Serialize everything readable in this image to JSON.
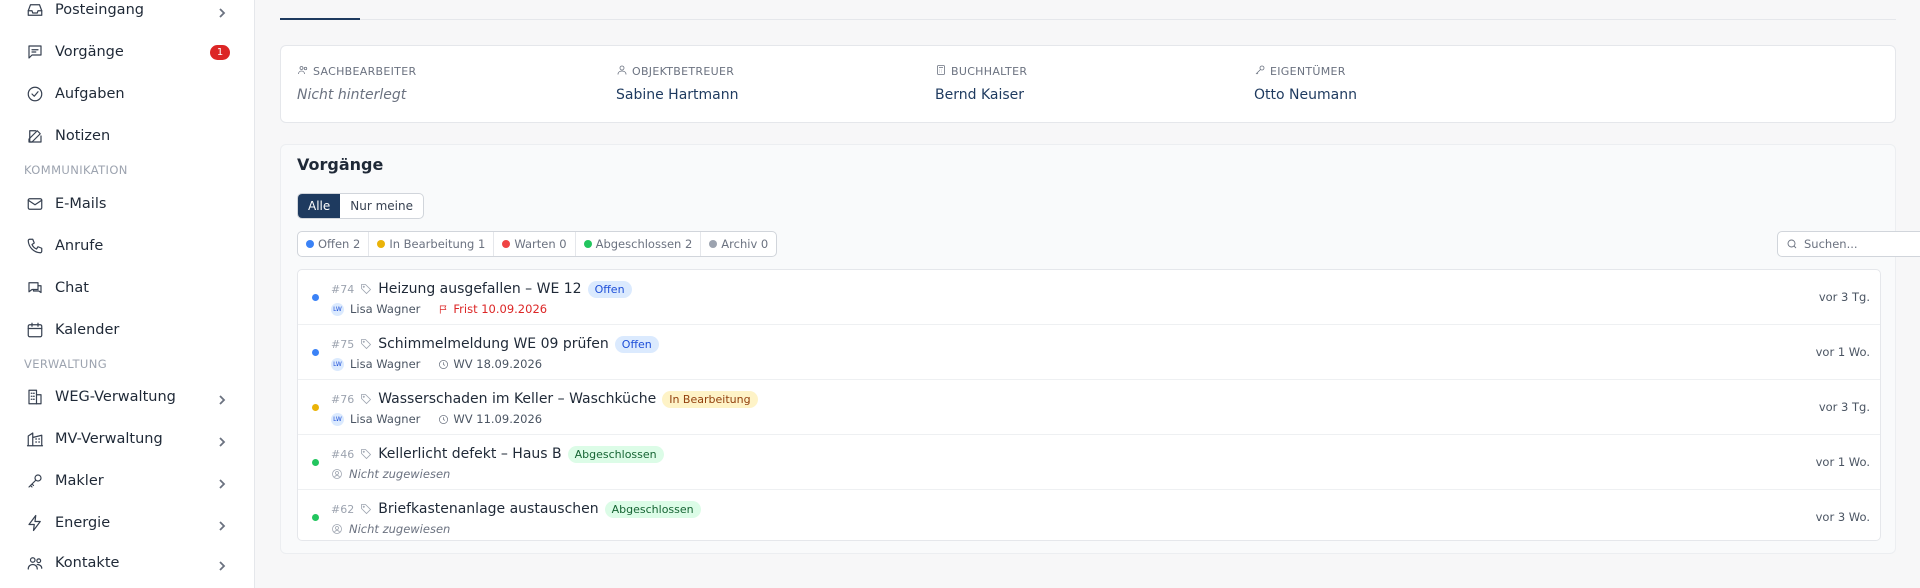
{
  "sidebar": {
    "items": [
      {
        "label": "Posteingang",
        "icon": "inbox-icon",
        "chevron": true
      },
      {
        "label": "Vorgänge",
        "icon": "message-square-icon",
        "badge": "1"
      },
      {
        "label": "Aufgaben",
        "icon": "check-circle-icon"
      },
      {
        "label": "Notizen",
        "icon": "edit-icon"
      }
    ],
    "section_kommunikation": "KOMMUNIKATION",
    "kommunikation": [
      {
        "label": "E-Mails",
        "icon": "mail-icon"
      },
      {
        "label": "Anrufe",
        "icon": "phone-icon"
      },
      {
        "label": "Chat",
        "icon": "chat-icon"
      },
      {
        "label": "Kalender",
        "icon": "calendar-icon"
      }
    ],
    "section_verwaltung": "VERWALTUNG",
    "verwaltung": [
      {
        "label": "WEG-Verwaltung",
        "icon": "building-icon",
        "chevron": true
      },
      {
        "label": "MV-Verwaltung",
        "icon": "buildings-icon",
        "chevron": true
      },
      {
        "label": "Makler",
        "icon": "key-icon",
        "chevron": true
      },
      {
        "label": "Energie",
        "icon": "bolt-icon",
        "chevron": true
      },
      {
        "label": "Kontakte",
        "icon": "users-icon",
        "chevron": true
      }
    ]
  },
  "people": {
    "sachbearbeiter": {
      "label": "SACHBEARBEITER",
      "value": "Nicht hinterlegt"
    },
    "objektbetreuer": {
      "label": "OBJEKTBETREUER",
      "value": "Sabine Hartmann"
    },
    "buchhalter": {
      "label": "BUCHHALTER",
      "value": "Bernd Kaiser"
    },
    "eigentuemer": {
      "label": "EIGENTÜMER",
      "value": "Otto Neumann"
    }
  },
  "vorgaenge": {
    "title": "Vorgänge",
    "seg_all": "Alle",
    "seg_mine": "Nur meine",
    "filters": [
      {
        "label": "Offen 2",
        "color": "#3b82f6"
      },
      {
        "label": "In Bearbeitung 1",
        "color": "#eab308"
      },
      {
        "label": "Warten 0",
        "color": "#ef4444"
      },
      {
        "label": "Abgeschlossen 2",
        "color": "#22c55e"
      },
      {
        "label": "Archiv 0",
        "color": "#9ca3af"
      }
    ],
    "search_placeholder": "Suchen...",
    "rows": [
      {
        "num": "#74",
        "title": "Heizung ausgefallen – WE 12",
        "status": "Offen",
        "dot": "#3b82f6",
        "assignee": "Lisa Wagner",
        "initials": "LW",
        "meta": "Frist 10.09.2026",
        "time": "vor 3 Tg."
      },
      {
        "num": "#75",
        "title": "Schimmelmeldung WE 09 prüfen",
        "status": "Offen",
        "dot": "#3b82f6",
        "assignee": "Lisa Wagner",
        "initials": "LW",
        "meta": "WV 18.09.2026",
        "time": "vor 1 Wo."
      },
      {
        "num": "#76",
        "title": "Wasserschaden im Keller – Waschküche",
        "status": "In Bearbeitung",
        "dot": "#eab308",
        "assignee": "Lisa Wagner",
        "initials": "LW",
        "meta": "WV 11.09.2026",
        "time": "vor 3 Tg."
      },
      {
        "num": "#46",
        "title": "Kellerlicht defekt – Haus B",
        "status": "Abgeschlossen",
        "dot": "#22c55e",
        "unassigned": "Nicht zugewiesen",
        "time": "vor 1 Wo."
      },
      {
        "num": "#62",
        "title": "Briefkastenanlage austauschen",
        "status": "Abgeschlossen",
        "dot": "#22c55e",
        "unassigned": "Nicht zugewiesen",
        "time": "vor 3 Wo."
      }
    ]
  },
  "colors": {
    "primary": "#1e3a5f",
    "badge": "#dc2626"
  }
}
